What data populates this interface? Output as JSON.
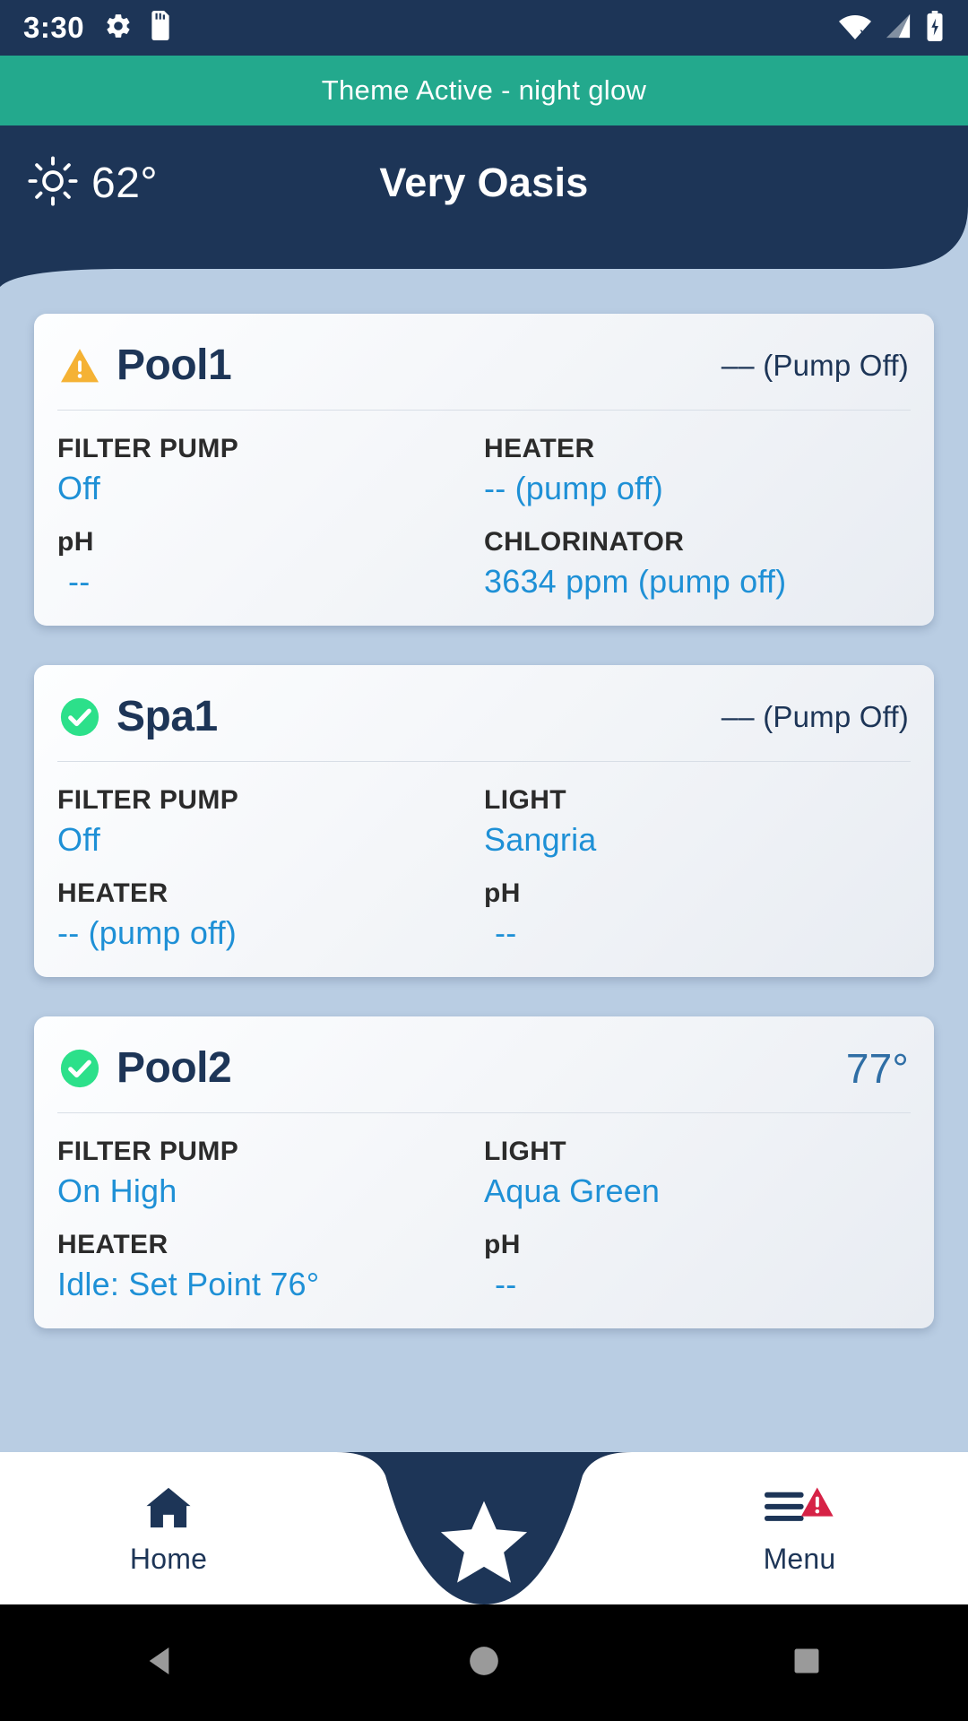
{
  "status_bar": {
    "time": "3:30",
    "left_icons": [
      "gear-icon",
      "sd-card-icon"
    ],
    "right_icons": [
      "wifi-off-icon",
      "cell-signal-icon",
      "battery-charging-icon"
    ]
  },
  "theme_banner": {
    "text": "Theme Active - night glow",
    "color": "#23a98d"
  },
  "header": {
    "weather_icon": "sun-icon",
    "temperature": "62°",
    "title": "Very Oasis",
    "background": "#1d3557"
  },
  "cards": [
    {
      "status_icon": "warning-icon",
      "name": "Pool1",
      "header_status": "–– (Pump Off)",
      "header_status_type": "text",
      "rows": [
        [
          {
            "label": "FILTER PUMP",
            "value": "Off",
            "indent": false
          },
          {
            "label": "HEATER",
            "value": "-- (pump off)",
            "indent": false
          }
        ],
        [
          {
            "label": "pH",
            "value": "--",
            "indent": true
          },
          {
            "label": "CHLORINATOR",
            "value": "3634 ppm (pump off)",
            "indent": false
          }
        ]
      ]
    },
    {
      "status_icon": "check-circle-icon",
      "name": "Spa1",
      "header_status": "–– (Pump Off)",
      "header_status_type": "text",
      "rows": [
        [
          {
            "label": "FILTER PUMP",
            "value": "Off",
            "indent": false
          },
          {
            "label": "LIGHT",
            "value": "Sangria",
            "indent": false
          }
        ],
        [
          {
            "label": "HEATER",
            "value": "-- (pump off)",
            "indent": false
          },
          {
            "label": "pH",
            "value": "--",
            "indent": true
          }
        ]
      ]
    },
    {
      "status_icon": "check-circle-icon",
      "name": "Pool2",
      "header_status": "77°",
      "header_status_type": "temp",
      "rows": [
        [
          {
            "label": "FILTER PUMP",
            "value": "On  High",
            "indent": false
          },
          {
            "label": "LIGHT",
            "value": "Aqua Green",
            "indent": false
          }
        ],
        [
          {
            "label": "HEATER",
            "value": "Idle: Set Point 76°",
            "indent": false
          },
          {
            "label": "pH",
            "value": "--",
            "indent": true
          }
        ]
      ]
    }
  ],
  "bottom_nav": {
    "home": {
      "icon": "home-icon",
      "label": "Home"
    },
    "fab": {
      "icon": "star-icon"
    },
    "menu": {
      "icon": "menu-alert-icon",
      "label": "Menu"
    }
  },
  "android_nav": {
    "back": "back-triangle-icon",
    "home": "home-circle-icon",
    "recents": "recents-square-icon"
  },
  "colors": {
    "navy": "#1d3557",
    "teal": "#23a98d",
    "link_blue": "#1e90d6",
    "warn_amber": "#f5b234",
    "ok_green": "#2ce08a",
    "alert_red": "#d62246",
    "page_bg": "#b9cde3"
  }
}
